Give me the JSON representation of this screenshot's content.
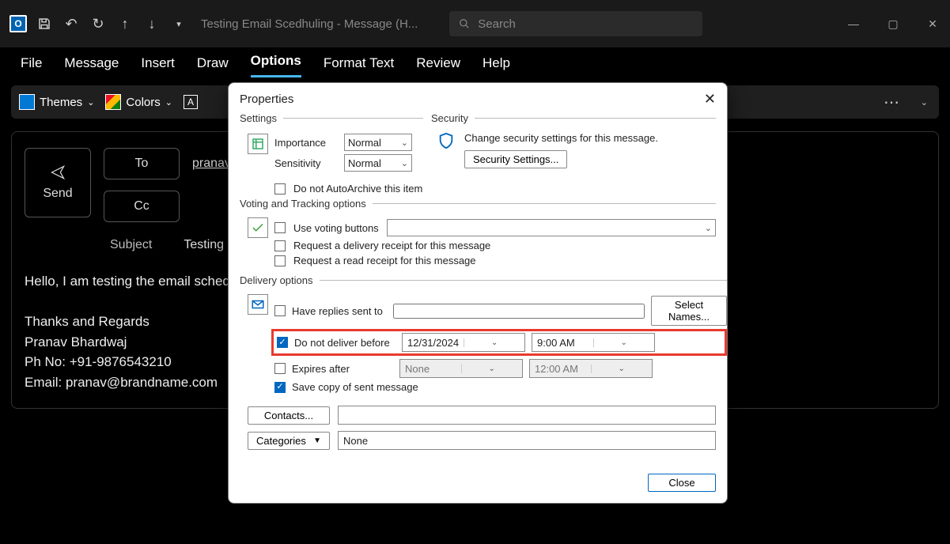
{
  "titlebar": {
    "app_glyph": "O",
    "title": "Testing Email Scedhuling  -  Message (H...",
    "search_placeholder": "Search"
  },
  "menu": {
    "items": [
      "File",
      "Message",
      "Insert",
      "Draw",
      "Options",
      "Format Text",
      "Review",
      "Help"
    ],
    "active": "Options"
  },
  "ribbon": {
    "themes": "Themes",
    "colors": "Colors"
  },
  "compose": {
    "send": "Send",
    "to": "To",
    "cc": "Cc",
    "to_value": "pranavb",
    "subject_label": "Subject",
    "subject_value": "Testing E",
    "body_line1": "Hello, I am testing the email scheduli",
    "sig1": "Thanks and Regards",
    "sig2": "Pranav Bhardwaj",
    "sig3": "Ph No: +91-9876543210",
    "sig4": "Email: pranav@brandname.com"
  },
  "dialog": {
    "title": "Properties",
    "settings_legend": "Settings",
    "security_legend": "Security",
    "importance_label": "Importance",
    "importance_value": "Normal",
    "sensitivity_label": "Sensitivity",
    "sensitivity_value": "Normal",
    "autoarchive": "Do not AutoArchive this item",
    "security_text": "Change security settings for this message.",
    "security_btn": "Security Settings...",
    "voting_legend": "Voting and Tracking options",
    "use_voting": "Use voting buttons",
    "delivery_receipt": "Request a delivery receipt for this message",
    "read_receipt": "Request a read receipt for this message",
    "delivery_legend": "Delivery options",
    "replies_to": "Have replies sent to",
    "select_names": "Select Names...",
    "no_deliver": "Do not deliver before",
    "no_deliver_date": "12/31/2024",
    "no_deliver_time": "9:00 AM",
    "expires": "Expires after",
    "expires_date": "None",
    "expires_time": "12:00 AM",
    "save_copy": "Save copy of sent message",
    "contacts": "Contacts...",
    "categories": "Categories",
    "categories_value": "None",
    "close": "Close"
  }
}
